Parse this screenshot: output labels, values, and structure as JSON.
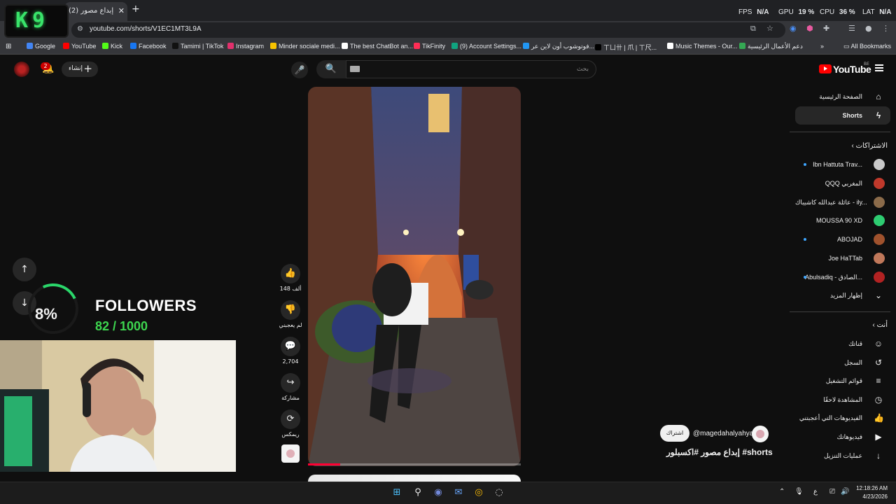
{
  "browser": {
    "tab_title": "إبداع مصور (2)",
    "url": "youtube.com/shorts/V1EC1MT3L9A",
    "bookmarks": [
      {
        "label": "Google",
        "color": "#4285f4"
      },
      {
        "label": "YouTube",
        "color": "#ff0000"
      },
      {
        "label": "Kick",
        "color": "#53fc18"
      },
      {
        "label": "Facebook",
        "color": "#1877f2"
      },
      {
        "label": "Tamimi | TikTok",
        "color": "#111111"
      },
      {
        "label": "Instagram",
        "color": "#e1306c"
      },
      {
        "label": "Minder sociale medi...",
        "color": "#f7c300"
      },
      {
        "label": "The best ChatBot an...",
        "color": "#ffffff"
      },
      {
        "label": "TikFinity",
        "color": "#ff2d55"
      },
      {
        "label": "(9) Account Settings...",
        "color": "#10a37f"
      },
      {
        "label": "فوتوشوب أون لاين عر...",
        "color": "#2196f3"
      },
      {
        "label": "ㄒㄩ卄 | 爪 | ㄒ尺...",
        "color": "#000000"
      },
      {
        "label": "Music Themes - Our...",
        "color": "#ffffff"
      },
      {
        "label": "دعم الأعمال الرئيسية",
        "color": "#34a853"
      }
    ],
    "all_bookmarks": "All Bookmarks"
  },
  "stream_overlay": {
    "logo": "K9",
    "fps_label": "FPS",
    "fps_value": "N/A",
    "gpu_label": "GPU",
    "gpu_value": "19 %",
    "cpu_label": "CPU",
    "cpu_value": "36 %",
    "lat_label": "LAT",
    "lat_value": "N/A",
    "goal_percent": "8%",
    "goal_fraction": 0.08,
    "followers_label": "FOLLOWERS",
    "followers_count": "82 / 1000"
  },
  "youtube": {
    "create_label": "إنشاء",
    "notification_count": "2",
    "search_placeholder": "بحث",
    "logo_text": "YouTube",
    "region": "BE",
    "sidebar": {
      "home": "الصفحة الرئيسية",
      "shorts": "Shorts",
      "subscriptions_header": "الاشتراكات",
      "subscriptions": [
        {
          "name": "Ibn Hattuta Trav...",
          "dot": true,
          "color": "#c9c9c9"
        },
        {
          "name": "QQQ المغربي",
          "dot": false,
          "color": "#c0392b"
        },
        {
          "name": "عائلة عبدالله كاشيباك - ily...",
          "dot": false,
          "color": "#8b6b4a"
        },
        {
          "name": "MOUSSA 90 XD",
          "dot": false,
          "color": "#2ecc71"
        },
        {
          "name": "ABOJAD",
          "dot": true,
          "color": "#a0522d"
        },
        {
          "name": "Joe HaTTab",
          "dot": false,
          "color": "#c0785a"
        },
        {
          "name": "Abulsadiq - الصادق...",
          "dot": true,
          "color": "#b22222"
        }
      ],
      "show_more": "إظهار المزيد",
      "you_header": "أنت",
      "you_items": [
        {
          "label": "قناتك",
          "icon": "channel-icon",
          "glyph": "☺"
        },
        {
          "label": "السجل",
          "icon": "history-icon",
          "glyph": "↺"
        },
        {
          "label": "قوائم التشغيل",
          "icon": "playlists-icon",
          "glyph": "≡"
        },
        {
          "label": "المشاهدة لاحقًا",
          "icon": "watch-later-icon",
          "glyph": "◷"
        },
        {
          "label": "الفيديوهات التي أعجبتني",
          "icon": "liked-icon",
          "glyph": "👍"
        },
        {
          "label": "فيديوهاتك",
          "icon": "your-videos-icon",
          "glyph": "▶"
        },
        {
          "label": "عمليات التنزيل",
          "icon": "downloads-icon",
          "glyph": "↓"
        }
      ]
    },
    "short": {
      "likes": "148 ألف",
      "dislike_label": "لم يعجبني",
      "comments": "2,704",
      "share_label": "مشاركة",
      "remix_label": "ريمكس",
      "channel": "@magedahalyahya",
      "subscribe_label": "اشتراك",
      "title": "إبداع مصور #اكسبلور #shorts",
      "progress": 0.15
    }
  },
  "taskbar": {
    "time": "12:18:26 AM",
    "date": "4/23/2026",
    "lang": "ع"
  }
}
